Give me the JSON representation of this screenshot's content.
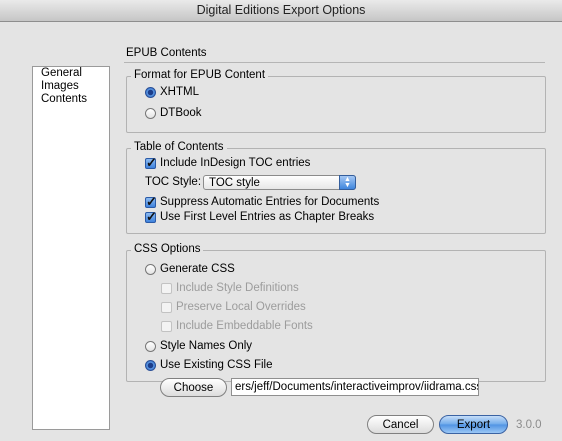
{
  "window": {
    "title": "Digital Editions Export Options"
  },
  "sidebar": {
    "items": [
      {
        "label": "General"
      },
      {
        "label": "Images"
      },
      {
        "label": "Contents"
      }
    ]
  },
  "section": {
    "title": "EPUB Contents"
  },
  "format": {
    "legend": "Format for EPUB Content",
    "xhtml": "XHTML",
    "dtbook": "DTBook",
    "selected": "XHTML"
  },
  "toc": {
    "legend": "Table of Contents",
    "include_indesign": "Include InDesign TOC entries",
    "style_label": "TOC Style:",
    "style_value": "TOC style",
    "suppress": "Suppress Automatic Entries for Documents",
    "first_level": "Use First Level Entries as Chapter Breaks"
  },
  "css": {
    "legend": "CSS Options",
    "generate": "Generate CSS",
    "include_style_defs": "Include Style Definitions",
    "preserve_overrides": "Preserve Local Overrides",
    "include_fonts": "Include Embeddable Fonts",
    "style_names_only": "Style Names Only",
    "use_existing": "Use Existing CSS File",
    "choose_label": "Choose",
    "path_value": "ers/jeff/Documents/interactiveimprov/iidrama.css",
    "selected": "Use Existing CSS File"
  },
  "footer": {
    "cancel_label": "Cancel",
    "export_label": "Export",
    "version": "3.0.0"
  }
}
